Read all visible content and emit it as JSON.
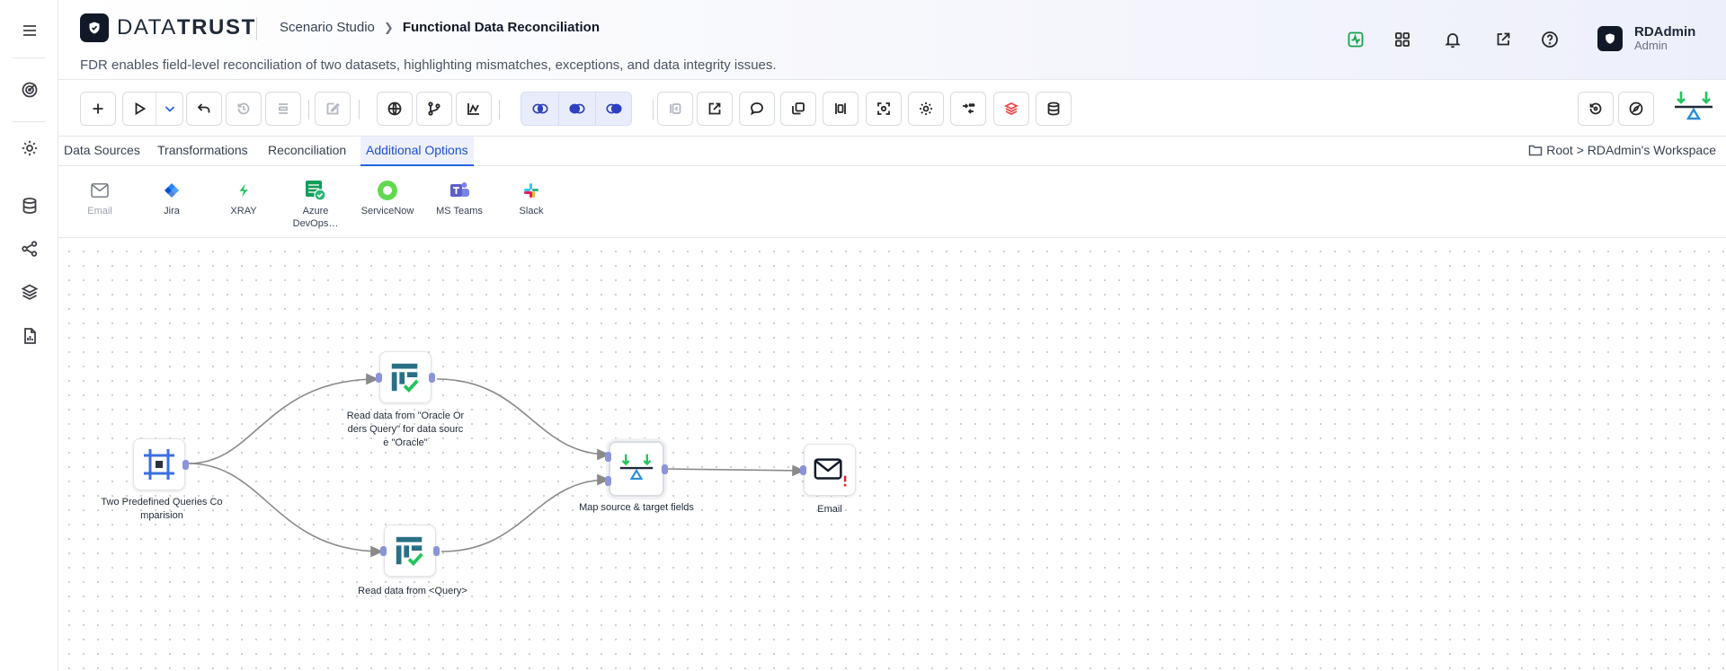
{
  "app": {
    "logo_light": "DATA",
    "logo_bold": "TRUST",
    "breadcrumb_parent": "Scenario Studio",
    "breadcrumb_current": "Functional Data Reconciliation",
    "description": "FDR enables field-level reconciliation of two datasets, highlighting mismatches, exceptions, and data integrity issues."
  },
  "header_icons": [
    "activity-icon",
    "apps-grid-icon",
    "bell-icon",
    "external-link-icon",
    "help-icon"
  ],
  "user": {
    "name": "RDAdmin",
    "role": "Admin"
  },
  "sidebar": {
    "items": [
      "menu-icon",
      "target-icon",
      "settings-icon",
      "database-icon",
      "hierarchy-icon",
      "layers-icon",
      "report-icon"
    ]
  },
  "tabs": [
    {
      "label": "Data Sources",
      "active": false
    },
    {
      "label": "Transformations",
      "active": false
    },
    {
      "label": "Reconciliation",
      "active": false
    },
    {
      "label": "Additional Options",
      "active": true
    }
  ],
  "workspace_path": "Root > RDAdmin's Workspace",
  "integrations": [
    {
      "label": "Email",
      "enabled": false,
      "color": "#9ca3af"
    },
    {
      "label": "Jira",
      "enabled": true,
      "color": "#2684ff"
    },
    {
      "label": "XRAY",
      "enabled": true,
      "color": "#22c55e"
    },
    {
      "label": "Azure DevOps…",
      "enabled": true,
      "color": "#0f9d58"
    },
    {
      "label": "ServiceNow",
      "enabled": true,
      "color": "#62d84e"
    },
    {
      "label": "MS Teams",
      "enabled": true,
      "color": "#5b5fc7"
    },
    {
      "label": "Slack",
      "enabled": true,
      "color": "#e01e5a"
    }
  ],
  "workflow": {
    "nodes": [
      {
        "id": "start",
        "label": "Two Predefined Queries Co mparision",
        "icon": "crop-frame-icon"
      },
      {
        "id": "read1",
        "label": "Read data from \"Oracle Or ders Query\" for data sourc e \"Oracle\"",
        "icon": "table-check-icon"
      },
      {
        "id": "read2",
        "label": "Read data from <Query>",
        "icon": "table-check-icon"
      },
      {
        "id": "map",
        "label": "Map source & target fields",
        "icon": "balance-scale-icon"
      },
      {
        "id": "email",
        "label": "Email",
        "icon": "mail-alert-icon"
      }
    ],
    "edges": [
      [
        "start",
        "read1"
      ],
      [
        "start",
        "read2"
      ],
      [
        "read1",
        "map"
      ],
      [
        "read2",
        "map"
      ],
      [
        "map",
        "email"
      ]
    ]
  },
  "colors": {
    "accent": "#2563eb",
    "port": "#8b93d9",
    "edge": "#8a8a8a",
    "node_teal": "#2a6f86",
    "check_green": "#22c55e",
    "alert_red": "#dc2626"
  }
}
